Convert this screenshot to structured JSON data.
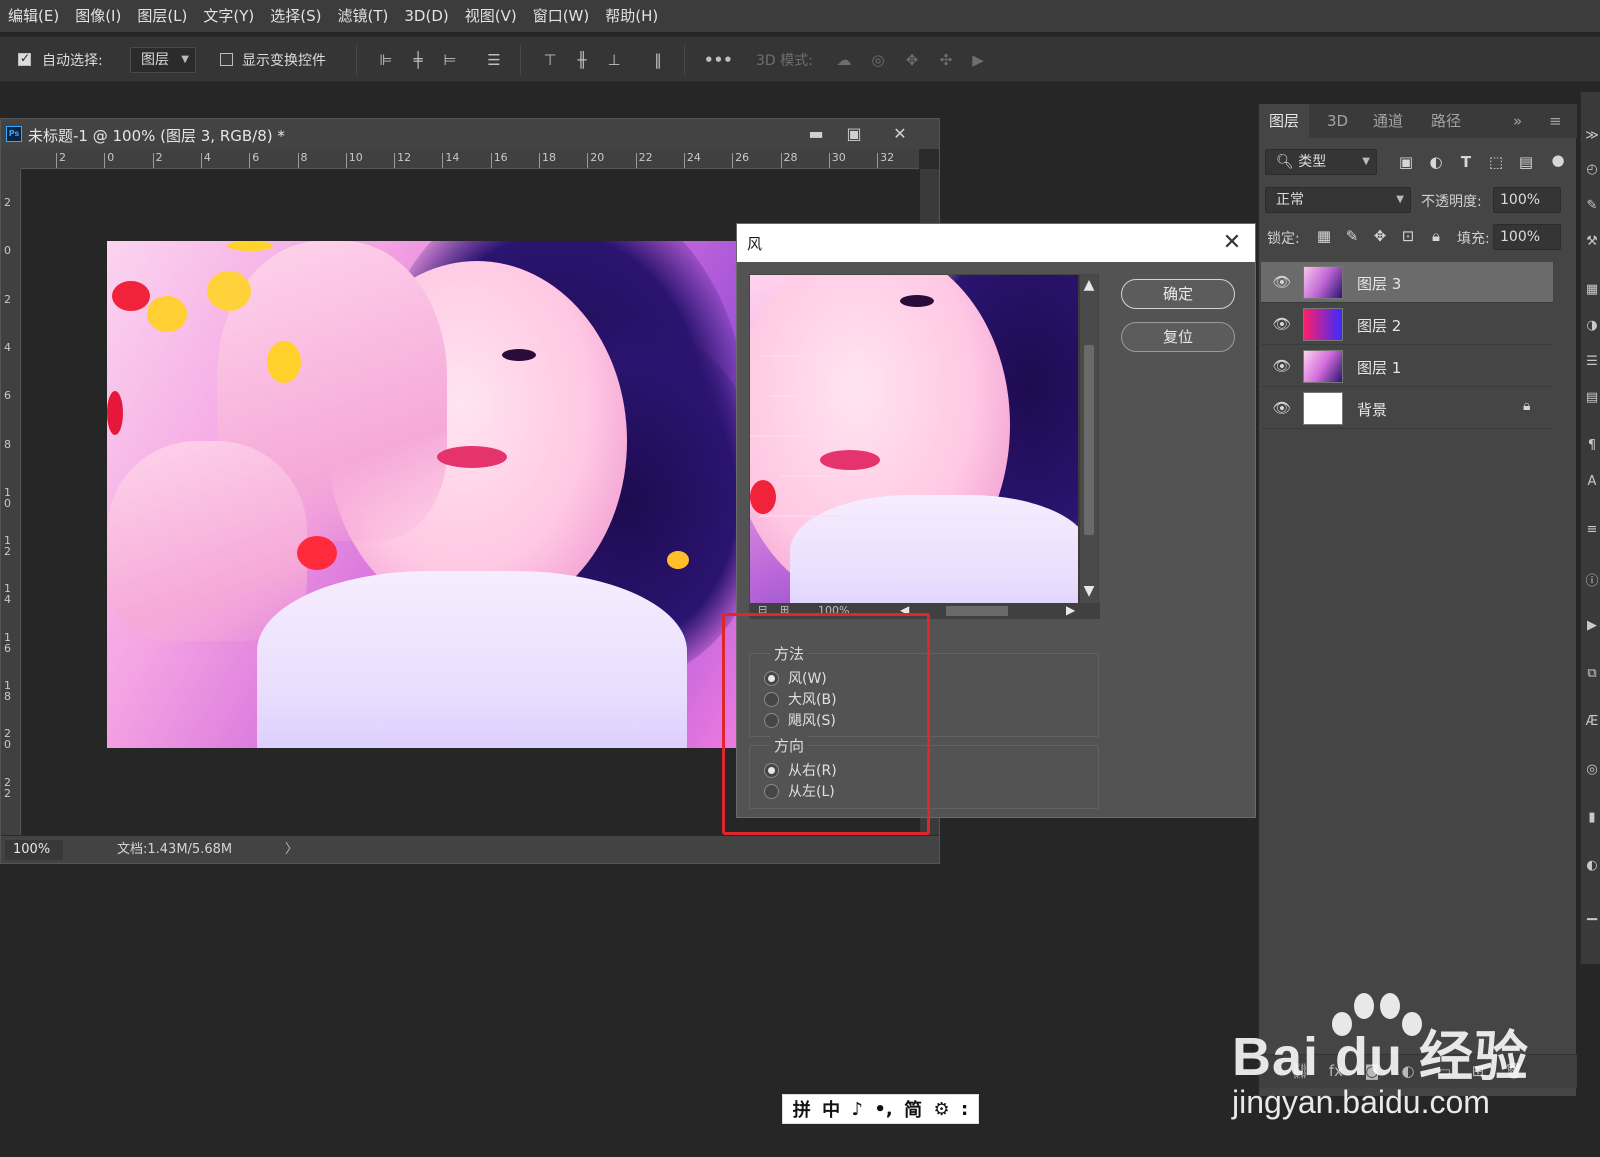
{
  "menubar": {
    "items": [
      "编辑(E)",
      "图像(I)",
      "图层(L)",
      "文字(Y)",
      "选择(S)",
      "滤镜(T)",
      "3D(D)",
      "视图(V)",
      "窗口(W)",
      "帮助(H)"
    ]
  },
  "options_bar": {
    "auto_select_label": "自动选择:",
    "auto_select_checked": true,
    "target_value": "图层",
    "show_transform_label": "显示变换控件",
    "show_transform_checked": false,
    "mode_3d_label": "3D 模式:"
  },
  "document": {
    "title": "未标题-1 @ 100% (图层 3, RGB/8) *",
    "ruler_h_labels": [
      "2",
      "0",
      "2",
      "4",
      "6",
      "8",
      "10",
      "12",
      "14",
      "16",
      "18",
      "20",
      "22",
      "24",
      "26",
      "28",
      "30",
      "32"
    ],
    "ruler_v_labels": [
      "2",
      "0",
      "2",
      "4",
      "6",
      "8",
      "10",
      "12",
      "14",
      "16",
      "18",
      "20",
      "22"
    ],
    "zoom": "100%",
    "doc_info": "文档:1.43M/5.68M",
    "doc_info_arrow": "〉"
  },
  "wind_dialog": {
    "title": "风",
    "preview_zoom": "100%",
    "ok_label": "确定",
    "reset_label": "复位",
    "method_group": {
      "title": "方法",
      "options": [
        {
          "label": "风(W)",
          "selected": true
        },
        {
          "label": "大风(B)",
          "selected": false
        },
        {
          "label": "飓风(S)",
          "selected": false
        }
      ]
    },
    "direction_group": {
      "title": "方向",
      "options": [
        {
          "label": "从右(R)",
          "selected": true
        },
        {
          "label": "从左(L)",
          "selected": false
        }
      ]
    }
  },
  "layers_panel": {
    "tabs": [
      "图层",
      "3D",
      "通道",
      "路径"
    ],
    "active_tab": "图层",
    "filter_kind": "类型",
    "blend_mode": "正常",
    "opacity_label": "不透明度:",
    "opacity_value": "100%",
    "lock_label": "锁定:",
    "fill_label": "填充:",
    "fill_value": "100%",
    "layers": [
      {
        "name": "图层 3",
        "selected": true,
        "locked": false,
        "thumb": "photo"
      },
      {
        "name": "图层 2",
        "selected": false,
        "locked": false,
        "thumb": "gradient"
      },
      {
        "name": "图层 1",
        "selected": false,
        "locked": false,
        "thumb": "photo"
      },
      {
        "name": "背景",
        "selected": false,
        "locked": true,
        "thumb": "white"
      }
    ]
  },
  "ime_bar": {
    "items": [
      "拼",
      "中",
      "♪",
      "•,",
      "简",
      "⚙",
      ":"
    ]
  },
  "watermark": {
    "logo": "Bai du 经验",
    "url": "jingyan.baidu.com"
  },
  "colors": {
    "highlight_red": "#e0262b",
    "ps_blue": "#31a8ff",
    "gradient_layer": [
      "#ff1f6a",
      "#3a2bff"
    ]
  }
}
